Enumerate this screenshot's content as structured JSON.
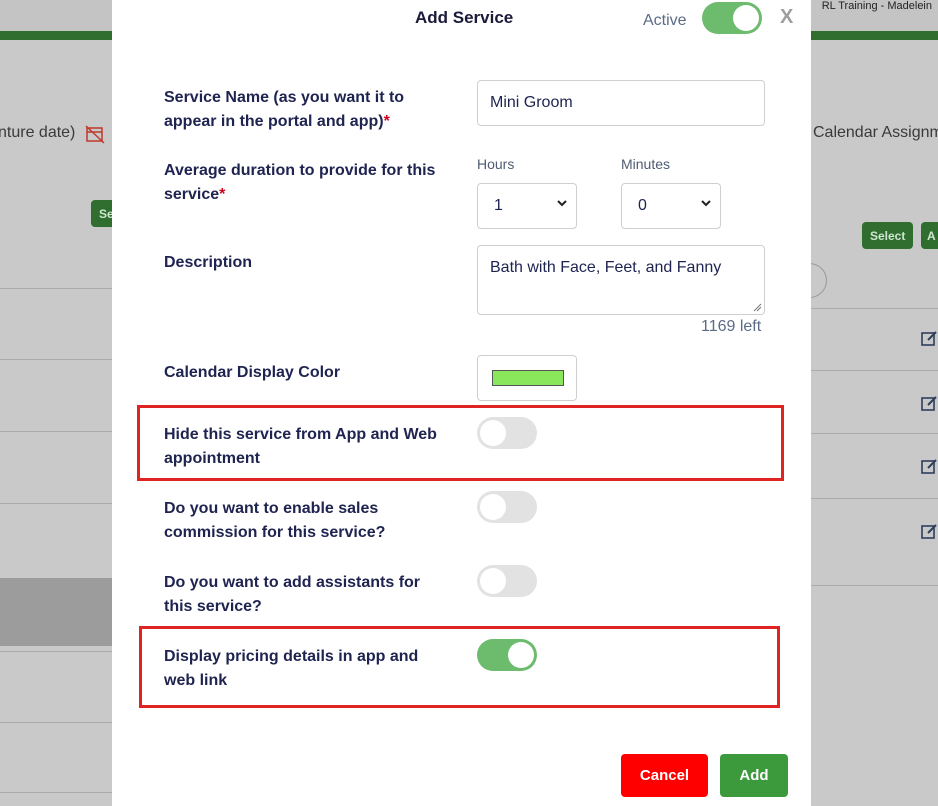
{
  "background": {
    "user_label": "RL Training - Madelein",
    "left_fragment": "nture date)",
    "right_fragment": "Calendar Assignm",
    "select_button": "Select",
    "left_button_fragment": "Se",
    "right_button_fragment": "A"
  },
  "modal": {
    "title": "Add Service",
    "active_label": "Active",
    "active_on": true,
    "close_label": "X",
    "service_name": {
      "label": "Service Name (as you want it to appear in the portal and app)",
      "required_mark": "*",
      "value": "Mini Groom"
    },
    "duration": {
      "label": "Average duration to provide for this service",
      "required_mark": "*",
      "hours_label": "Hours",
      "hours_value": "1",
      "minutes_label": "Minutes",
      "minutes_value": "0"
    },
    "description": {
      "label": "Description",
      "value": "Bath with Face, Feet, and Fanny",
      "counter": "1169 left"
    },
    "color": {
      "label": "Calendar Display Color",
      "value": "#8ae65a"
    },
    "hide_service": {
      "label": "Hide this service from App and Web appointment",
      "on": false
    },
    "commission": {
      "label": "Do you want to enable sales commission for this service?",
      "on": false
    },
    "assistants": {
      "label": "Do you want to add assistants for this service?",
      "on": false
    },
    "pricing": {
      "label": "Display pricing details in app and web link",
      "on": true
    },
    "cancel_label": "Cancel",
    "add_label": "Add"
  }
}
